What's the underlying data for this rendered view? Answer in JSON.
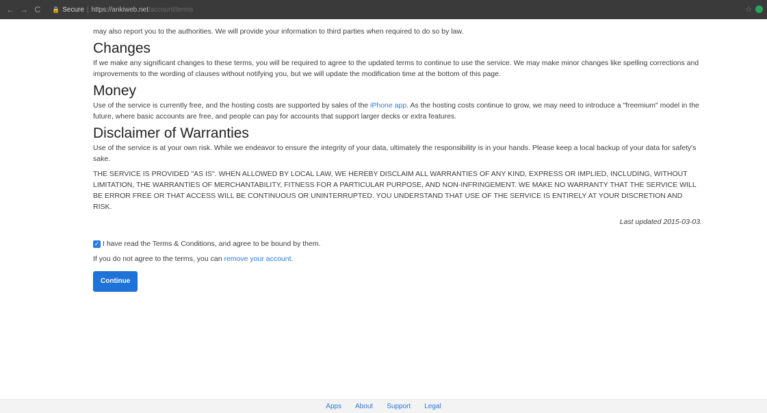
{
  "browser": {
    "back_glyph": "←",
    "forward_glyph": "→",
    "reload_glyph": "C",
    "secure_label": "Secure",
    "separator": "|",
    "url_host": "https://ankiweb.net",
    "url_path": "/account/terms",
    "star_glyph": "☆"
  },
  "page": {
    "intro_tail": "may also report you to the authorities. We will provide your information to third parties when required to do so by law.",
    "changes": {
      "heading": "Changes",
      "body": "If we make any significant changes to these terms, you will be required to agree to the updated terms to continue to use the service. We may make minor changes like spelling corrections and improvements to the wording of clauses without notifying you, but we will update the modification time at the bottom of this page."
    },
    "money": {
      "heading": "Money",
      "body_before": "Use of the service is currently free, and the hosting costs are supported by sales of the ",
      "link": "iPhone app",
      "body_after": ". As the hosting costs continue to grow, we may need to introduce a \"freemium\" model in the future, where basic accounts are free, and people can pay for accounts that support larger decks or extra features."
    },
    "disclaimer": {
      "heading": "Disclaimer of Warranties",
      "body1": "Use of the service is at your own risk. While we endeavor to ensure the integrity of your data, ultimately the responsibility is in your hands. Please keep a local backup of your data for safety's sake.",
      "body2": "THE SERVICE IS PROVIDED \"AS IS\". WHEN ALLOWED BY LOCAL LAW, WE HEREBY DISCLAIM ALL WARRANTIES OF ANY KIND, EXPRESS OR IMPLIED, INCLUDING, WITHOUT LIMITATION, THE WARRANTIES OF MERCHANTABILITY, FITNESS FOR A PARTICULAR PURPOSE, AND NON-INFRINGEMENT. WE MAKE NO WARRANTY THAT THE SERVICE WILL BE ERROR FREE OR THAT ACCESS WILL BE CONTINUOUS OR UNINTERRUPTED. YOU UNDERSTAND THAT USE OF THE SERVICE IS ENTIRELY AT YOUR DISCRETION AND RISK."
    },
    "last_updated": "Last updated 2015-03-03.",
    "agree_label": "I have read the Terms & Conditions, and agree to be bound by them.",
    "agree_checked": true,
    "checkmark": "✓",
    "remove_before": "If you do not agree to the terms, you can ",
    "remove_link": "remove your account",
    "remove_after": ".",
    "continue_label": "Continue"
  },
  "footer": {
    "links": [
      "Apps",
      "About",
      "Support",
      "Legal"
    ]
  },
  "colors": {
    "link": "#2a7ae2",
    "button": "#1e73d8",
    "chrome": "#3a3a3a"
  }
}
